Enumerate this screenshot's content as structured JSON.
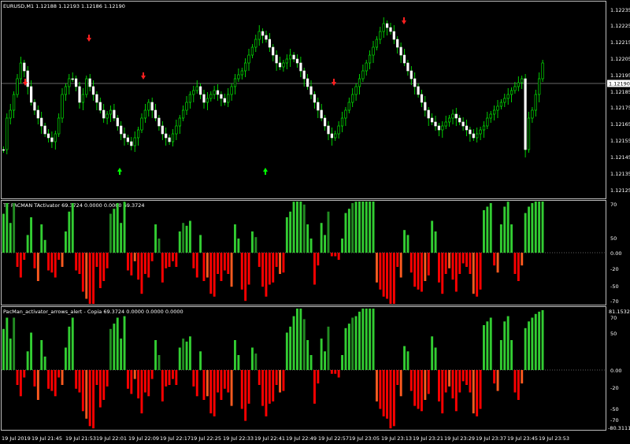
{
  "main_pane": {
    "header": "EURUSD,M1  1.12188 1.12193 1.12186 1.12190",
    "current_price": "1.12190",
    "price_ticks": [
      "1.12235",
      "1.12225",
      "1.12215",
      "1.12205",
      "1.12195",
      "1.12185",
      "1.12175",
      "1.12165",
      "1.12155",
      "1.12145",
      "1.12135",
      "1.12125"
    ],
    "arrow_up_color": "#00ff00",
    "arrow_down_color": "#ff2020",
    "candle_color": "#00ff00",
    "grid_color": "#bdbdbd"
  },
  "indicator_pane_1": {
    "header": "TT PACMAN TActivator 69.3724 0.0000 0.0000 69.3724",
    "ticks": [
      "70",
      "50",
      "0.00",
      "-20",
      "-50",
      "-70"
    ],
    "bullish_color": "#32cd32",
    "bearish_color": "#ff0000",
    "bearish_weak_color": "#ff5a1f",
    "bullish_weak_color": "#228b22"
  },
  "indicator_pane_2": {
    "header": "PacMan_activator_arrows_alert - Copia 69.3724 0.0000 0.0000 0.0000",
    "ticks": [
      "81.1532",
      "70",
      "50",
      "0.00",
      "-20",
      "-50",
      "-70",
      "-80.3111"
    ]
  },
  "time_axis": {
    "labels": [
      "19 Jul 2019",
      "19 Jul 21:45",
      "19 Jul 21:53",
      "19 Jul 22:01",
      "19 Jul 22:09",
      "19 Jul 22:17",
      "19 Jul 22:25",
      "19 Jul 22:33",
      "19 Jul 22:41",
      "19 Jul 22:49",
      "19 Jul 22:57",
      "19 Jul 23:05",
      "19 Jul 23:13",
      "19 Jul 23:21",
      "19 Jul 23:29",
      "19 Jul 23:37",
      "19 Jul 23:45",
      "19 Jul 23:53"
    ]
  },
  "chart_data": {
    "type": "bar",
    "title": "EURUSD,M1",
    "histogram_values": [
      55,
      70,
      42,
      70,
      -20,
      -35,
      -10,
      25,
      50,
      -22,
      -40,
      40,
      18,
      -25,
      -28,
      -35,
      -10,
      -20,
      30,
      58,
      70,
      -25,
      -30,
      -55,
      -65,
      -75,
      -78,
      -20,
      -50,
      -40,
      -22,
      55,
      62,
      70,
      42,
      72,
      -25,
      -32,
      -12,
      -38,
      -58,
      -30,
      -35,
      -12,
      40,
      20,
      -42,
      -22,
      -20,
      -12,
      -20,
      30,
      42,
      38,
      45,
      -22,
      -35,
      25,
      -40,
      -35,
      -58,
      -62,
      -30,
      -40,
      -25,
      -30,
      -48,
      40,
      20,
      -52,
      -68,
      -45,
      30,
      22,
      -20,
      -48,
      -62,
      -45,
      -42,
      -20,
      -30,
      -28,
      50,
      58,
      72,
      84,
      84,
      68,
      40,
      20,
      -45,
      -18,
      42,
      25,
      58,
      -5,
      -5,
      -10,
      20,
      56,
      62,
      70,
      72,
      78,
      84,
      84,
      84,
      84,
      -42,
      -52,
      -62,
      -65,
      -78,
      -75,
      -20,
      -35,
      32,
      25,
      -28,
      -48,
      -52,
      -55,
      -40,
      -32,
      45,
      30,
      -42,
      -58,
      -30,
      -22,
      -38,
      -55,
      -30,
      -15,
      -20,
      -30,
      -58,
      -62,
      -52,
      60,
      65,
      70,
      -18,
      -28,
      40,
      65,
      72,
      40,
      -30,
      -40,
      -18,
      56,
      65,
      70,
      75,
      78,
      80
    ]
  }
}
